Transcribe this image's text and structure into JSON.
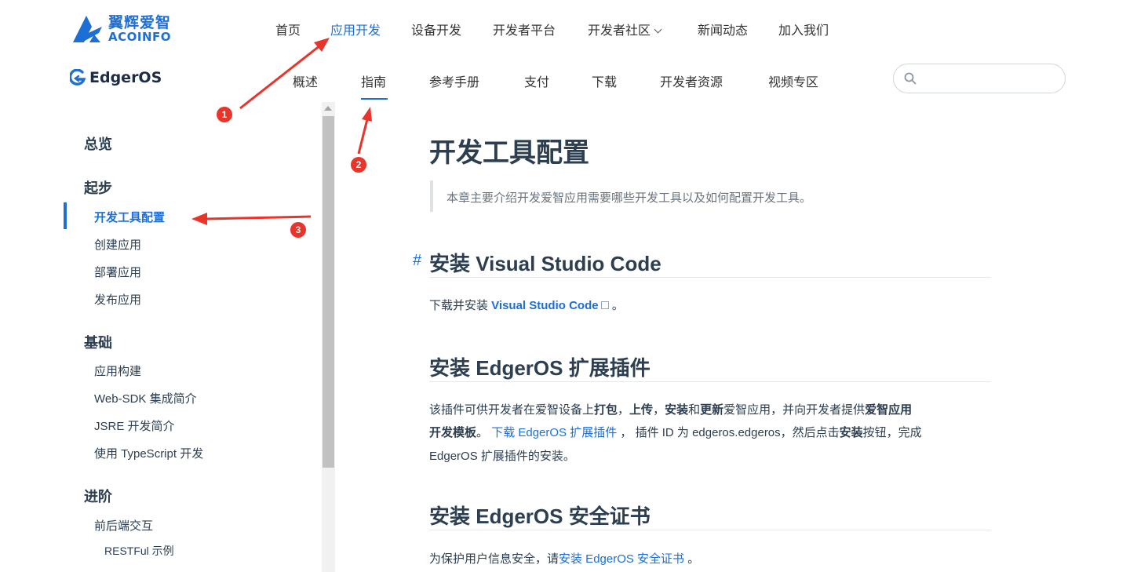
{
  "brand": {
    "name_cn": "翼辉爱智",
    "name_en": "ACOINFO",
    "color": "#1d6fd6"
  },
  "topnav": {
    "items": [
      {
        "label": "首页"
      },
      {
        "label": "应用开发",
        "active": true
      },
      {
        "label": "设备开发"
      },
      {
        "label": "开发者平台"
      },
      {
        "label": "开发者社区",
        "dropdown": true
      },
      {
        "label": "新闻动态"
      },
      {
        "label": "加入我们"
      }
    ]
  },
  "product": {
    "name": "EdgerOS"
  },
  "subnav": {
    "items": [
      {
        "label": "概述"
      },
      {
        "label": "指南",
        "active": true
      },
      {
        "label": "参考手册"
      },
      {
        "label": "支付"
      },
      {
        "label": "下载"
      },
      {
        "label": "开发者资源"
      },
      {
        "label": "视频专区"
      }
    ]
  },
  "search": {
    "placeholder": "",
    "value": ""
  },
  "sidebar": {
    "groups": [
      {
        "title": "总览"
      },
      {
        "title": "起步",
        "links": [
          "开发工具配置",
          "创建应用",
          "部署应用",
          "发布应用"
        ],
        "active": "开发工具配置"
      },
      {
        "title": "基础",
        "links": [
          "应用构建",
          "Web-SDK 集成简介",
          "JSRE 开发简介",
          "使用 TypeScript 开发"
        ]
      },
      {
        "title": "进阶",
        "links": [
          "前后端交互"
        ],
        "sublinks": [
          "RESTFul 示例"
        ]
      }
    ]
  },
  "content": {
    "title": "开发工具配置",
    "intro": "本章主要介绍开发爱智应用需要哪些开发工具以及如何配置开发工具。",
    "anchor": "#",
    "sections": [
      {
        "heading": "安装 Visual Studio Code",
        "text_before": "下载并安装 ",
        "link": "Visual Studio Code",
        "text_after": " 。"
      },
      {
        "heading": "安装 EdgerOS 扩展插件",
        "line1": {
          "t1": "该插件可供开发者在爱智设备上",
          "b1": "打包",
          "t2": "，",
          "b2": "上传",
          "t3": "，",
          "b3": "安装",
          "t4": "和",
          "b4": "更新",
          "t5": "爱智应用，并向开发者提供",
          "b5": "爱智应用"
        },
        "line2": {
          "b1": "开发模板",
          "t1": "。 ",
          "link": "下载 EdgerOS 扩展插件",
          "t2": " ， 插件 ID 为 edgeros.edgeros，然后点击",
          "b2": "安装",
          "t3": "按钮，完成"
        },
        "line3": "EdgerOS 扩展插件的安装。"
      },
      {
        "heading": "安装 EdgerOS 安全证书",
        "text_before": "为保护用户信息安全，请",
        "link": "安装 EdgerOS 安全证书",
        "text_after": " 。"
      }
    ]
  },
  "annotations": {
    "color": "#e8342b",
    "badges": [
      "1",
      "2",
      "3"
    ]
  }
}
